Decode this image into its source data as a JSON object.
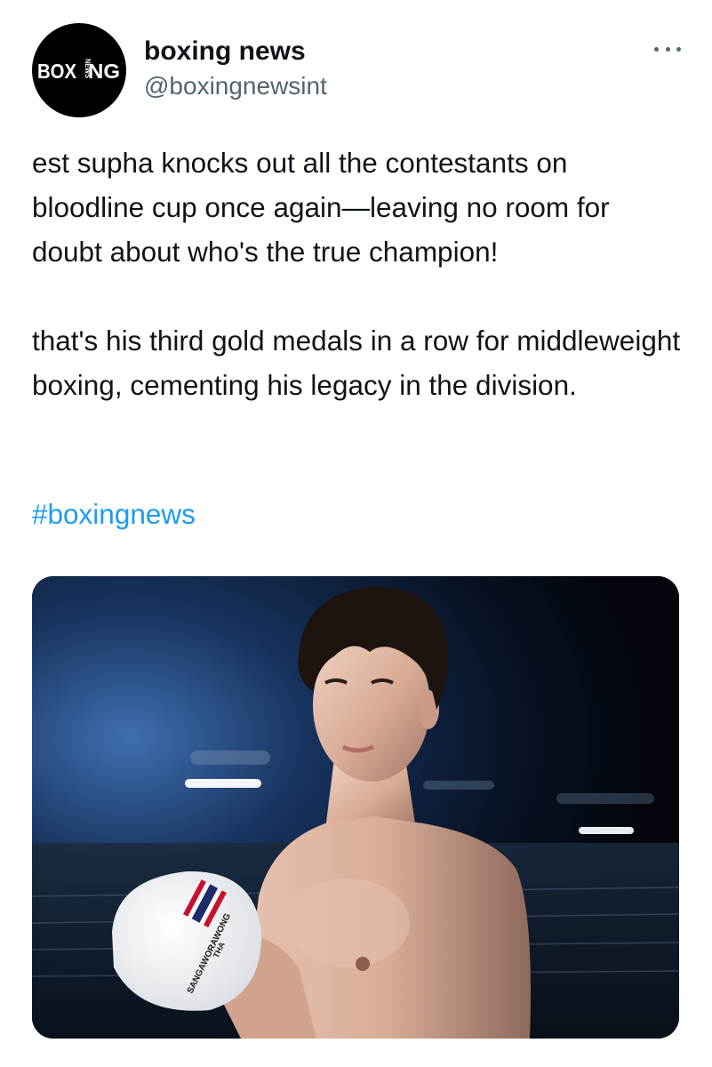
{
  "account": {
    "display_name": "boxing news",
    "handle": "@boxingnewsint",
    "avatar_logo": {
      "left": "BOX",
      "middle": "NEWS",
      "right": "NG"
    }
  },
  "tweet": {
    "paragraphs": [
      "est supha knocks out all the contestants on bloodline cup once again—leaving no room for doubt about who's the true champion!",
      "that's his third gold medals in a row for middleweight boxing, cementing his legacy in the division."
    ],
    "hashtag": "#boxingnews"
  },
  "media": {
    "cap_text_1": "THA",
    "cap_text_2": "SANGAWORAWONG",
    "flag_colors": [
      "#c8102e",
      "#ffffff",
      "#1d2d6b"
    ]
  },
  "icons": {
    "more": "more-horizontal-icon"
  },
  "colors": {
    "text": "#0f1419",
    "secondary": "#536471",
    "link": "#1d9bf0",
    "avatar_bg": "#000000"
  }
}
